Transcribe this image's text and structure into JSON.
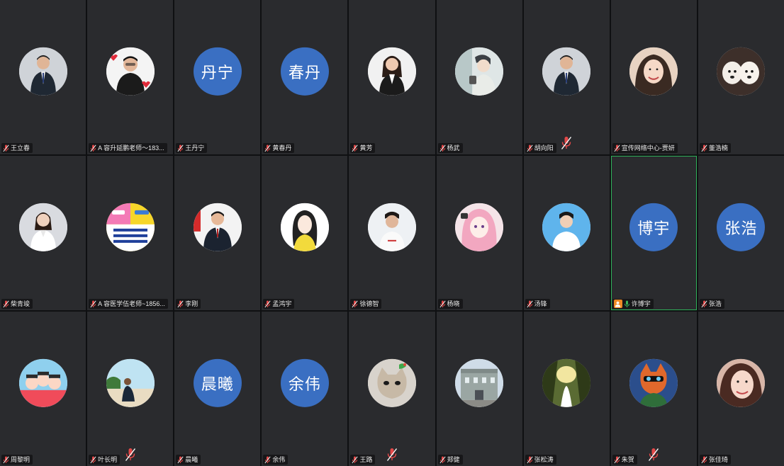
{
  "colors": {
    "tile_bg": "#2a2b2e",
    "avatar_blue": "#3a6fc2",
    "active_border": "#2fb25a",
    "host_badge": "#f08a24",
    "mic_on": "#3db35a",
    "mic_muted": "#e34848"
  },
  "participants": [
    {
      "name": "王立春",
      "avatar_text": "",
      "avatar_type": "photo",
      "photo_hint": "man-in-suit"
    },
    {
      "name": "A 容升延鹏老师～183...",
      "avatar_text": "",
      "avatar_type": "photo",
      "photo_hint": "man-with-hearts"
    },
    {
      "name": "王丹宁",
      "avatar_text": "丹宁",
      "avatar_type": "text"
    },
    {
      "name": "黄春丹",
      "avatar_text": "春丹",
      "avatar_type": "text"
    },
    {
      "name": "黄芳",
      "avatar_text": "",
      "avatar_type": "photo",
      "photo_hint": "woman-in-suit"
    },
    {
      "name": "杨武",
      "avatar_text": "",
      "avatar_type": "photo",
      "photo_hint": "illustrated-man"
    },
    {
      "name": "胡向阳",
      "avatar_text": "",
      "avatar_type": "photo",
      "photo_hint": "man-in-suit",
      "center_muted": true
    },
    {
      "name": "宣传网络中心-贾妍",
      "avatar_text": "",
      "avatar_type": "photo",
      "photo_hint": "smiling-woman"
    },
    {
      "name": "董浩楠",
      "avatar_text": "",
      "avatar_type": "photo",
      "photo_hint": "puppies"
    },
    {
      "name": "柴青竣",
      "avatar_text": "",
      "avatar_type": "photo",
      "photo_hint": "woman-white-shirt"
    },
    {
      "name": "A 容医学伍老师~1856...",
      "avatar_text": "",
      "avatar_type": "photo",
      "photo_hint": "poster"
    },
    {
      "name": "李刚",
      "avatar_text": "",
      "avatar_type": "photo",
      "photo_hint": "man-in-suit-flag"
    },
    {
      "name": "孟鸿宇",
      "avatar_text": "",
      "avatar_type": "photo",
      "photo_hint": "sketch-girl"
    },
    {
      "name": "徐德智",
      "avatar_text": "",
      "avatar_type": "photo",
      "photo_hint": "young-man"
    },
    {
      "name": "杨晓",
      "avatar_text": "",
      "avatar_type": "photo",
      "photo_hint": "anime-girl"
    },
    {
      "name": "汤锋",
      "avatar_text": "",
      "avatar_type": "photo",
      "photo_hint": "id-photo"
    },
    {
      "name": "许博宇",
      "avatar_text": "博宇",
      "avatar_type": "text",
      "active": true,
      "host": true
    },
    {
      "name": "张浩",
      "avatar_text": "张浩",
      "avatar_type": "text"
    },
    {
      "name": "周黎明",
      "avatar_text": "",
      "avatar_type": "photo",
      "photo_hint": "cartoon-group"
    },
    {
      "name": "叶长明",
      "avatar_text": "",
      "avatar_type": "photo",
      "photo_hint": "man-outdoors",
      "center_muted": true
    },
    {
      "name": "晨曦",
      "avatar_text": "晨曦",
      "avatar_type": "text"
    },
    {
      "name": "余伟",
      "avatar_text": "余伟",
      "avatar_type": "text"
    },
    {
      "name": "王路",
      "avatar_text": "",
      "avatar_type": "photo",
      "photo_hint": "cat-with-bird",
      "center_muted": true
    },
    {
      "name": "郑健",
      "avatar_text": "",
      "avatar_type": "photo",
      "photo_hint": "building"
    },
    {
      "name": "张松涛",
      "avatar_text": "",
      "avatar_type": "photo",
      "photo_hint": "forest-bride"
    },
    {
      "name": "朱贺",
      "avatar_text": "",
      "avatar_type": "photo",
      "photo_hint": "cartoon-fox",
      "center_muted": true
    },
    {
      "name": "张佳琦",
      "avatar_text": "",
      "avatar_type": "photo",
      "photo_hint": "woman-closeup"
    }
  ]
}
